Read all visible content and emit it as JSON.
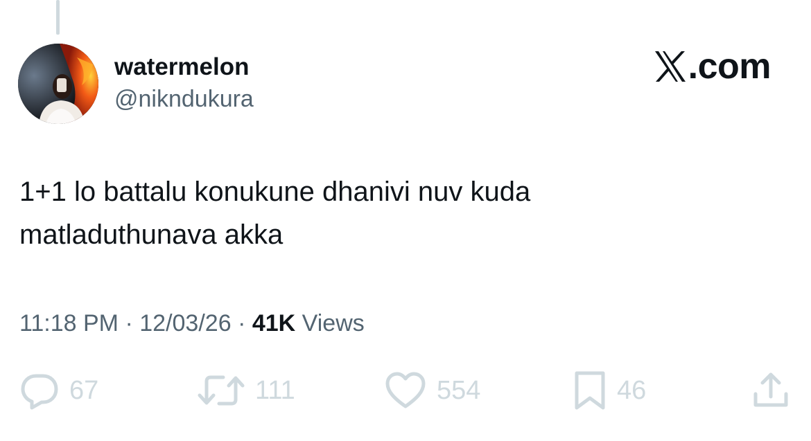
{
  "tweet": {
    "display_name": "watermelon",
    "handle": "@nikndukura",
    "text_lines": [
      "1+1 lo battalu konukune dhanivi nuv kuda",
      "matladuthunava akka"
    ],
    "time": "11:18 PM",
    "separator": "·",
    "date": "12/03/26",
    "views_count": "41K",
    "views_label": "Views"
  },
  "brand": {
    "suffix": ".com"
  },
  "actions": {
    "replies": "67",
    "reposts": "111",
    "likes": "554",
    "bookmarks": "46"
  },
  "colors": {
    "text": "#0f1419",
    "secondary": "#536471",
    "icon_muted": "#cfd9de",
    "background": "#ffffff"
  },
  "icons": {
    "reply": "reply-bubble-icon",
    "repost": "repost-arrows-icon",
    "like": "heart-icon",
    "bookmark": "bookmark-icon",
    "share": "share-upload-icon",
    "brand": "x-logo-icon"
  }
}
